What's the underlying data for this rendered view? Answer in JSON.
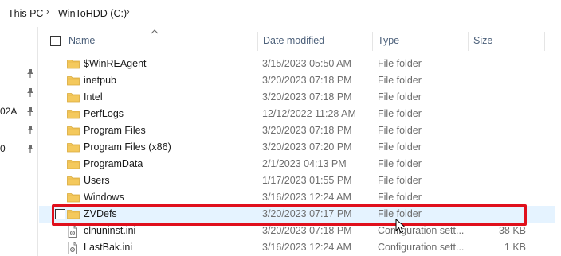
{
  "breadcrumb": {
    "items": [
      "This PC",
      "WinToHDD (C:)"
    ]
  },
  "nav": {
    "partial_labels": [
      "02A",
      "0"
    ]
  },
  "columns": {
    "name": "Name",
    "date": "Date modified",
    "type": "Type",
    "size": "Size"
  },
  "rows": [
    {
      "name": "$WinREAgent",
      "date": "3/15/2023 05:50 AM",
      "type": "File folder",
      "size": "",
      "icon": "folder-icon"
    },
    {
      "name": "inetpub",
      "date": "3/20/2023 07:18 PM",
      "type": "File folder",
      "size": "",
      "icon": "folder-icon"
    },
    {
      "name": "Intel",
      "date": "3/20/2023 07:18 PM",
      "type": "File folder",
      "size": "",
      "icon": "folder-icon"
    },
    {
      "name": "PerfLogs",
      "date": "12/12/2022 11:28 AM",
      "type": "File folder",
      "size": "",
      "icon": "folder-icon"
    },
    {
      "name": "Program Files",
      "date": "3/20/2023 07:18 PM",
      "type": "File folder",
      "size": "",
      "icon": "folder-icon"
    },
    {
      "name": "Program Files (x86)",
      "date": "3/20/2023 07:20 PM",
      "type": "File folder",
      "size": "",
      "icon": "folder-icon"
    },
    {
      "name": "ProgramData",
      "date": "2/1/2023 04:13 PM",
      "type": "File folder",
      "size": "",
      "icon": "folder-icon"
    },
    {
      "name": "Users",
      "date": "1/17/2023 01:55 PM",
      "type": "File folder",
      "size": "",
      "icon": "folder-icon"
    },
    {
      "name": "Windows",
      "date": "3/16/2023 12:24 AM",
      "type": "File folder",
      "size": "",
      "icon": "folder-icon"
    },
    {
      "name": "ZVDefs",
      "date": "3/20/2023 07:17 PM",
      "type": "File folder",
      "size": "",
      "icon": "folder-icon",
      "selected": true
    },
    {
      "name": "clnuninst.ini",
      "date": "3/20/2023 07:18 PM",
      "type": "Configuration sett...",
      "size": "38 KB",
      "icon": "ini-file-icon"
    },
    {
      "name": "LastBak.ini",
      "date": "3/16/2023 12:24 AM",
      "type": "Configuration sett...",
      "size": "1 KB",
      "icon": "ini-file-icon"
    }
  ],
  "colors": {
    "selection": "#e5f3ff",
    "highlight": "#e0101c",
    "folder": "#f4c95d",
    "header_text": "#4c607a"
  }
}
